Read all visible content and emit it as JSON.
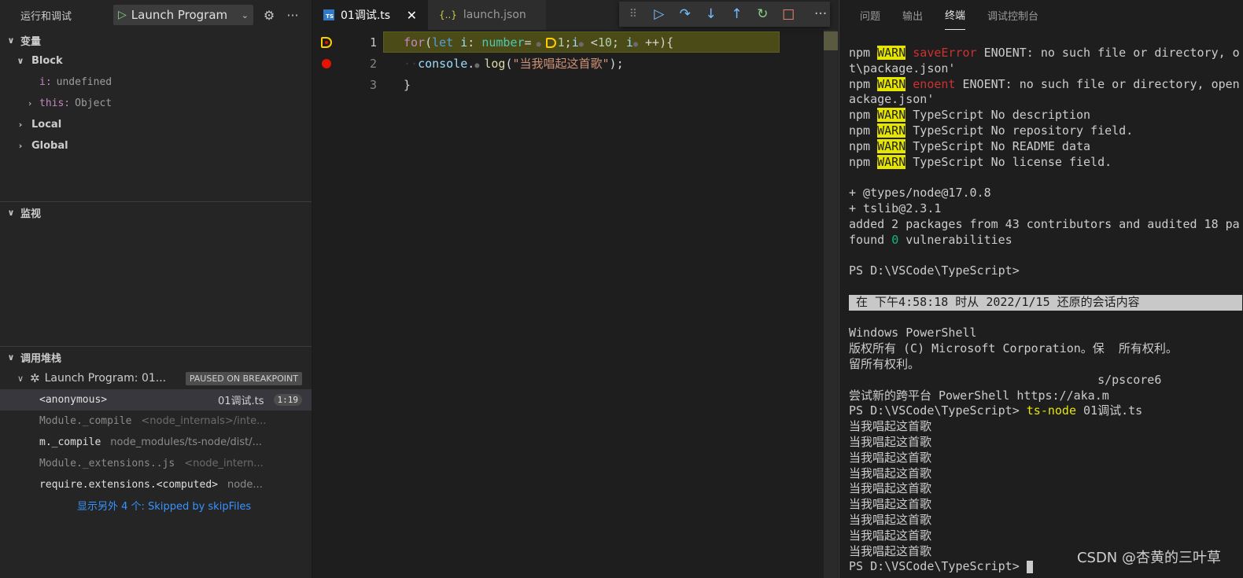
{
  "sidebar": {
    "title": "运行和调试",
    "launch_config": "Launch Program",
    "variables": {
      "header": "变量",
      "block_label": "Block",
      "items": [
        {
          "name": "i:",
          "value": "undefined"
        },
        {
          "name": "this:",
          "value": "Object"
        }
      ],
      "local_label": "Local",
      "global_label": "Global"
    },
    "watch": {
      "header": "监视"
    },
    "callstack": {
      "header": "调用堆栈",
      "session": "Launch Program: 01...",
      "status": "PAUSED ON BREAKPOINT",
      "frames": [
        {
          "fn": "<anonymous>",
          "src": "01调试.ts",
          "line": "1:19"
        },
        {
          "fn": "Module._compile",
          "src": "<node_internals>/inte..."
        },
        {
          "fn": "m._compile",
          "src": "node_modules/ts-node/dist/..."
        },
        {
          "fn": "Module._extensions..js",
          "src": "<node_intern..."
        },
        {
          "fn": "require.extensions.<computed>",
          "src": "node..."
        }
      ],
      "skipped": "显示另外 4 个: Skipped by skipFiles"
    }
  },
  "editor": {
    "tabs": [
      {
        "label": "01调试.ts",
        "icon": "ts-file-icon",
        "icon_text": "TS",
        "active": true
      },
      {
        "label": "launch.json",
        "icon": "json-file-icon",
        "icon_text": "{..}",
        "active": false
      }
    ],
    "line_numbers": [
      "1",
      "2",
      "3"
    ],
    "debug_toolbar": [
      "drag-handle-icon",
      "continue-icon",
      "step-over-icon",
      "step-into-icon",
      "step-out-icon",
      "restart-icon",
      "stop-icon"
    ],
    "code": {
      "l1": {
        "for": "for",
        "p1": "(",
        "let": "let",
        "i1": " i",
        "colon": ": ",
        "number": "number",
        "eq": "=",
        "one": "1",
        "semi1": ";",
        "i2": "i",
        "lt": " <",
        "ten": "10",
        "semi2": ";",
        "i3": " i",
        "pp": " ++){"
      },
      "l2": {
        "console": "console",
        "log": "log",
        "p1": "(",
        "str": "\"当我唱起这首歌\"",
        "p2": ");"
      },
      "l3": {
        "brace": "}"
      }
    }
  },
  "panel": {
    "tabs": [
      "问题",
      "输出",
      "终端",
      "调试控制台"
    ],
    "active_tab": "终端",
    "terminal": {
      "warn_lines": [
        {
          "pre": "npm ",
          "tag": "WARN",
          "kind": "saveError",
          "text": " ENOENT: no such file or directory, o"
        },
        {
          "plain": "t\\package.json'"
        },
        {
          "pre": "npm ",
          "tag": "WARN",
          "kind": "enoent",
          "text": " ENOENT: no such file or directory, open"
        },
        {
          "plain": "ackage.json'"
        },
        {
          "pre": "npm ",
          "tag": "WARN",
          "text": " TypeScript No description"
        },
        {
          "pre": "npm ",
          "tag": "WARN",
          "text": " TypeScript No repository field."
        },
        {
          "pre": "npm ",
          "tag": "WARN",
          "text": " TypeScript No README data"
        },
        {
          "pre": "npm ",
          "tag": "WARN",
          "text": " TypeScript No license field."
        }
      ],
      "pkg1": "+ @types/node@17.0.8",
      "pkg2": "+ tslib@2.3.1",
      "added": "added 2 packages from 43 contributors and audited 18 pa",
      "found_pre": "found ",
      "found_num": "0",
      "found_post": " vulnerabilities",
      "prompt1": "PS D:\\VSCode\\TypeScript>",
      "restore": " 在 下午4:58:18 时从 2022/1/15 还原的会话内容",
      "ps_title": "Windows PowerShell",
      "copyright": "版权所有 (C) Microsoft Corporation。保  所有权利。",
      "copyright2": "留所有权利。",
      "pscore": "                                   s/pscore6",
      "try_new": "尝试新的跨平台 PowerShell https://aka.m",
      "prompt2": "PS D:\\VSCode\\TypeScript> ",
      "cmd": "ts-node",
      "cmd_arg": " 01调试.ts",
      "output_line": "当我唱起这首歌",
      "output_count": 9,
      "prompt3": "PS D:\\VSCode\\TypeScript> "
    },
    "watermark": "CSDN @杏黄的三叶草"
  }
}
